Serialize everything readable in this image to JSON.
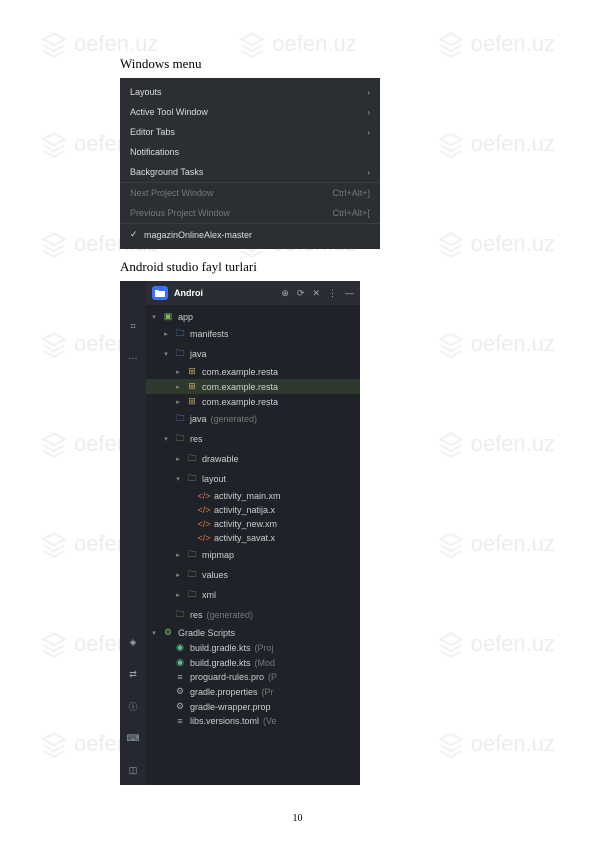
{
  "watermark": {
    "text": "oefen.uz"
  },
  "heading1": "Windows menu",
  "heading2": "Android studio fayl turlari",
  "page_number": "10",
  "windows_menu": {
    "items": [
      {
        "label": "Layouts",
        "arrow": true,
        "enabled": true
      },
      {
        "label": "Active Tool Window",
        "arrow": true,
        "enabled": true
      },
      {
        "label": "Editor Tabs",
        "arrow": true,
        "enabled": true
      },
      {
        "label": "Notifications",
        "arrow": false,
        "enabled": true
      },
      {
        "label": "Background Tasks",
        "arrow": true,
        "enabled": true
      },
      {
        "label": "Next Project Window",
        "shortcut": "Ctrl+Alt+]",
        "enabled": false,
        "sep": true
      },
      {
        "label": "Previous Project Window",
        "shortcut": "Ctrl+Alt+[",
        "enabled": false
      },
      {
        "label": "magazinOnlineAlex-master",
        "checked": true,
        "enabled": true,
        "sep": true
      }
    ]
  },
  "project_panel": {
    "header": {
      "title": "Androi"
    },
    "tree": [
      {
        "level": 0,
        "caret": "v",
        "icon": "module",
        "label": "app"
      },
      {
        "level": 1,
        "caret": ">",
        "icon": "folder-blue",
        "label": "manifests"
      },
      {
        "level": 1,
        "caret": "v",
        "icon": "folder-blue",
        "label": "java"
      },
      {
        "level": 2,
        "caret": ">",
        "icon": "pkg",
        "label": "com.example.resta"
      },
      {
        "level": 2,
        "caret": ">",
        "icon": "pkg",
        "label": "com.example.resta",
        "selected": true
      },
      {
        "level": 2,
        "caret": ">",
        "icon": "pkg",
        "label": "com.example.resta"
      },
      {
        "level": 1,
        "caret": "",
        "icon": "folder-blue",
        "label": "java",
        "suffix": "(generated)"
      },
      {
        "level": 1,
        "caret": "v",
        "icon": "folder",
        "label": "res"
      },
      {
        "level": 2,
        "caret": ">",
        "icon": "folder",
        "label": "drawable"
      },
      {
        "level": 2,
        "caret": "v",
        "icon": "folder",
        "label": "layout"
      },
      {
        "level": 3,
        "caret": "",
        "icon": "xml",
        "label": "activity_main.xm"
      },
      {
        "level": 3,
        "caret": "",
        "icon": "xml",
        "label": "activity_natija.x"
      },
      {
        "level": 3,
        "caret": "",
        "icon": "xml",
        "label": "activity_new.xm"
      },
      {
        "level": 3,
        "caret": "",
        "icon": "xml",
        "label": "activity_savat.x"
      },
      {
        "level": 2,
        "caret": ">",
        "icon": "folder",
        "label": "mipmap"
      },
      {
        "level": 2,
        "caret": ">",
        "icon": "folder",
        "label": "values"
      },
      {
        "level": 2,
        "caret": ">",
        "icon": "folder",
        "label": "xml"
      },
      {
        "level": 1,
        "caret": "",
        "icon": "folder",
        "label": "res",
        "suffix": "(generated)"
      },
      {
        "level": 0,
        "caret": "v",
        "icon": "gradle-root",
        "label": "Gradle Scripts"
      },
      {
        "level": 1,
        "caret": "",
        "icon": "gradle",
        "label": "build.gradle.kts",
        "suffix": "(Proj"
      },
      {
        "level": 1,
        "caret": "",
        "icon": "gradle",
        "label": "build.gradle.kts",
        "suffix": "(Mod"
      },
      {
        "level": 1,
        "caret": "",
        "icon": "file",
        "label": "proguard-rules.pro",
        "suffix": "(P"
      },
      {
        "level": 1,
        "caret": "",
        "icon": "gear",
        "label": "gradle.properties",
        "suffix": "(Pr"
      },
      {
        "level": 1,
        "caret": "",
        "icon": "gear",
        "label": "gradle-wrapper.prop"
      },
      {
        "level": 1,
        "caret": "",
        "icon": "file",
        "label": "libs.versions.toml",
        "suffix": "(Ve"
      }
    ]
  }
}
